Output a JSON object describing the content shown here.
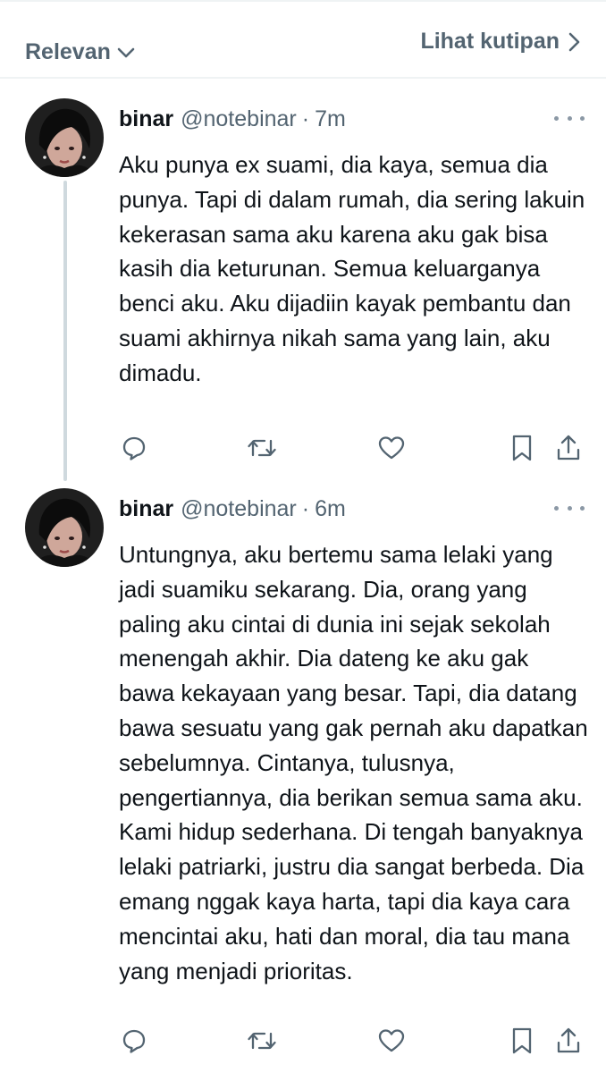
{
  "header": {
    "sort_label": "Relevan",
    "quotes_label": "Lihat kutipan"
  },
  "tweets": [
    {
      "name": "binar",
      "handle": "@notebinar",
      "separator": "·",
      "time": "7m",
      "text": "Aku punya ex suami, dia kaya, semua dia punya. Tapi di dalam rumah, dia sering lakuin kekerasan sama aku karena aku gak bisa kasih dia keturunan. Semua keluarganya benci aku. Aku dijadiin kayak pembantu dan suami akhirnya nikah sama yang lain, aku dimadu."
    },
    {
      "name": "binar",
      "handle": "@notebinar",
      "separator": "·",
      "time": "6m",
      "text": "Untungnya, aku bertemu sama lelaki yang jadi suamiku sekarang. Dia, orang yang paling aku cintai di dunia ini sejak sekolah menengah akhir. Dia dateng ke aku gak bawa kekayaan yang besar. Tapi, dia datang bawa sesuatu yang gak pernah aku dapatkan sebelumnya. Cintanya, tulusnya, pengertiannya, dia berikan semua sama aku. Kami hidup sederhana. Di tengah banyaknya lelaki patriarki, justru dia sangat berbeda. Dia emang nggak kaya harta, tapi dia kaya cara mencintai aku, hati dan moral, dia tau mana yang menjadi prioritas."
    }
  ],
  "colors": {
    "text": "#0f1419",
    "secondary": "#536471",
    "thread_line": "#cfd9de",
    "divider": "#eff3f4"
  },
  "icons": [
    "chevron-down-icon",
    "chevron-right-icon",
    "more-icon",
    "reply-icon",
    "retweet-icon",
    "like-icon",
    "bookmark-icon",
    "share-icon"
  ]
}
